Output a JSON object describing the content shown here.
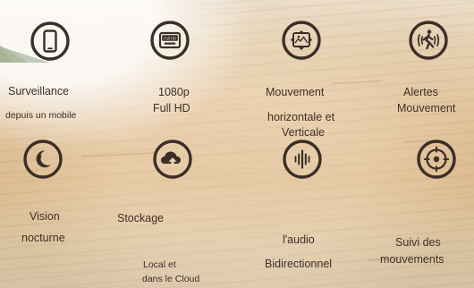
{
  "features": {
    "surveillance": {
      "icon": "smartphone-icon",
      "title": "Surveillance",
      "subtitle": "depuis un mobile"
    },
    "resolution": {
      "icon": "full-hd-icon",
      "title": "1080p",
      "subtitle": "Full HD",
      "badge": "Full HD"
    },
    "movement": {
      "icon": "pan-tilt-icon",
      "title": "Mouvement",
      "subtitle_line1": "horizontale et",
      "subtitle_line2": "Verticale"
    },
    "alerts": {
      "icon": "motion-person-icon",
      "title": "Alertes",
      "subtitle": "Mouvement"
    },
    "night_vision": {
      "icon": "moon-star-icon",
      "title": "Vision",
      "subtitle": "nocturne"
    },
    "storage": {
      "icon": "cloud-upload-icon",
      "title": "Stockage",
      "subtitle_line1": "Local et",
      "subtitle_line2": "dans le Cloud"
    },
    "audio": {
      "icon": "sound-wave-icon",
      "title": "l'audio",
      "subtitle": "Bidirectionnel"
    },
    "tracking": {
      "icon": "target-icon",
      "title": "Suivi des",
      "subtitle": "mouvements"
    }
  },
  "colors": {
    "icon": "#3a2f27",
    "text": "#3d3129"
  }
}
